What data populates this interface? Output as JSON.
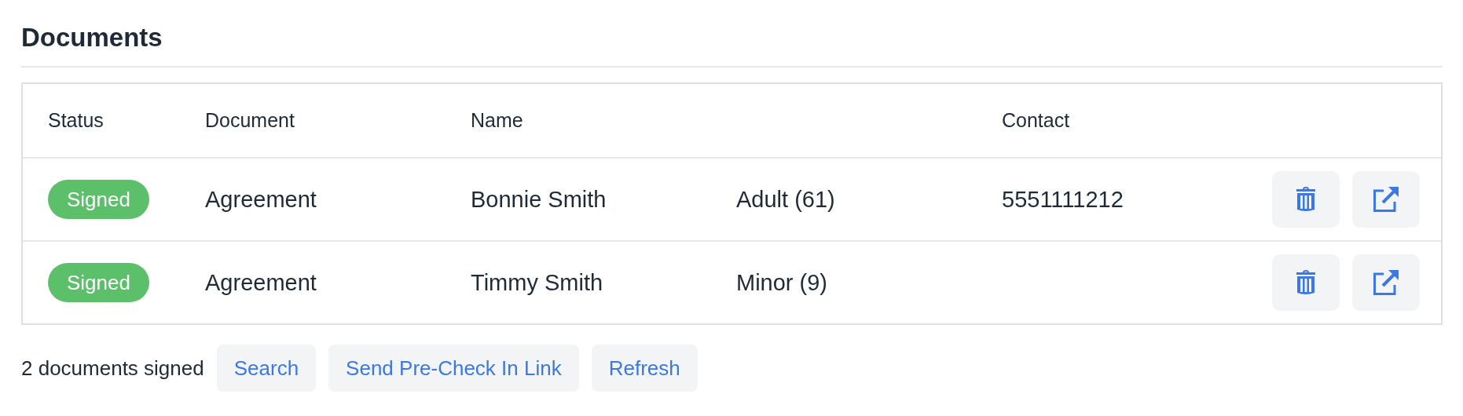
{
  "title": "Documents",
  "table": {
    "columns": [
      "Status",
      "Document",
      "Name",
      "Contact"
    ],
    "rows": [
      {
        "status": "Signed",
        "document": "Agreement",
        "name": "Bonnie Smith",
        "age": "Adult (61)",
        "contact": "5551111212"
      },
      {
        "status": "Signed",
        "document": "Agreement",
        "name": "Timmy Smith",
        "age": "Minor (9)"
      }
    ]
  },
  "footer": {
    "summary": "2 documents signed",
    "buttons": [
      "Search",
      "Send Pre-Check In Link",
      "Refresh"
    ]
  }
}
